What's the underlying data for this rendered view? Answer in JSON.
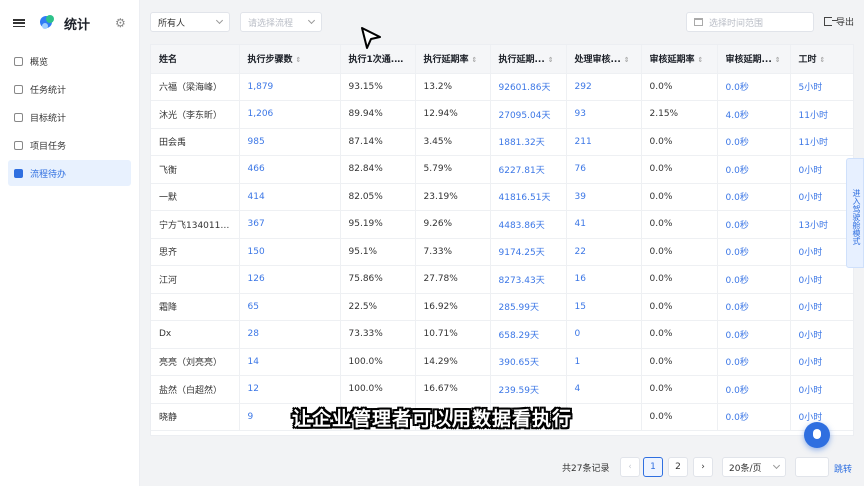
{
  "app": {
    "title": "统计"
  },
  "sidebar": {
    "items": [
      {
        "label": "概览",
        "active": false
      },
      {
        "label": "任务统计",
        "active": false
      },
      {
        "label": "目标统计",
        "active": false
      },
      {
        "label": "项目任务",
        "active": false
      },
      {
        "label": "流程待办",
        "active": true
      }
    ]
  },
  "toolbar": {
    "owner_value": "所有人",
    "flow_placeholder": "请选择流程",
    "date_placeholder": "选择时间范围",
    "export_label": "导出"
  },
  "table": {
    "columns": [
      "姓名",
      "执行步骤数",
      "执行1次通...",
      "执行延期率",
      "执行延期...",
      "处理审核...",
      "审核延期率",
      "审核延期...",
      "工时"
    ],
    "rows": [
      [
        "六福（梁海峰）",
        "1,879",
        "93.15%",
        "13.2%",
        "92601.86天",
        "292",
        "0.0%",
        "0.0秒",
        "5小时"
      ],
      [
        "沐光（李东昕）",
        "1,206",
        "89.94%",
        "12.94%",
        "27095.04天",
        "93",
        "2.15%",
        "4.0秒",
        "11小时"
      ],
      [
        "田会禹",
        "985",
        "87.14%",
        "3.45%",
        "1881.32天",
        "211",
        "0.0%",
        "0.0秒",
        "11小时"
      ],
      [
        "飞衡",
        "466",
        "82.84%",
        "5.79%",
        "6227.81天",
        "76",
        "0.0%",
        "0.0秒",
        "0小时"
      ],
      [
        "一默",
        "414",
        "82.05%",
        "23.19%",
        "41816.51天",
        "39",
        "0.0%",
        "0.0秒",
        "0小时"
      ],
      [
        "宁方飞13401135...",
        "367",
        "95.19%",
        "9.26%",
        "4483.86天",
        "41",
        "0.0%",
        "0.0秒",
        "13小时"
      ],
      [
        "思齐",
        "150",
        "95.1%",
        "7.33%",
        "9174.25天",
        "22",
        "0.0%",
        "0.0秒",
        "0小时"
      ],
      [
        "江河",
        "126",
        "75.86%",
        "27.78%",
        "8273.43天",
        "16",
        "0.0%",
        "0.0秒",
        "0小时"
      ],
      [
        "霜降",
        "65",
        "22.5%",
        "16.92%",
        "285.99天",
        "15",
        "0.0%",
        "0.0秒",
        "0小时"
      ],
      [
        "Dx",
        "28",
        "73.33%",
        "10.71%",
        "658.29天",
        "0",
        "0.0%",
        "0.0秒",
        "0小时"
      ],
      [
        "亮亮（刘亮亮）",
        "14",
        "100.0%",
        "14.29%",
        "390.65天",
        "1",
        "0.0%",
        "0.0秒",
        "0小时"
      ],
      [
        "盐然（白超然）",
        "12",
        "100.0%",
        "16.67%",
        "239.59天",
        "4",
        "0.0%",
        "0.0秒",
        "0小时"
      ],
      [
        "晓静",
        "9",
        "",
        "",
        "",
        "",
        "0.0%",
        "0.0秒",
        "0小时"
      ]
    ]
  },
  "subtitle": "让企业管理者可以用数据看执行",
  "side_tab": "进入驾驶舱模式",
  "pagination": {
    "total": "共27条记录",
    "pages": [
      "1",
      "2"
    ],
    "current": "1",
    "page_size": "20条/页",
    "jump_label": "跳转"
  }
}
